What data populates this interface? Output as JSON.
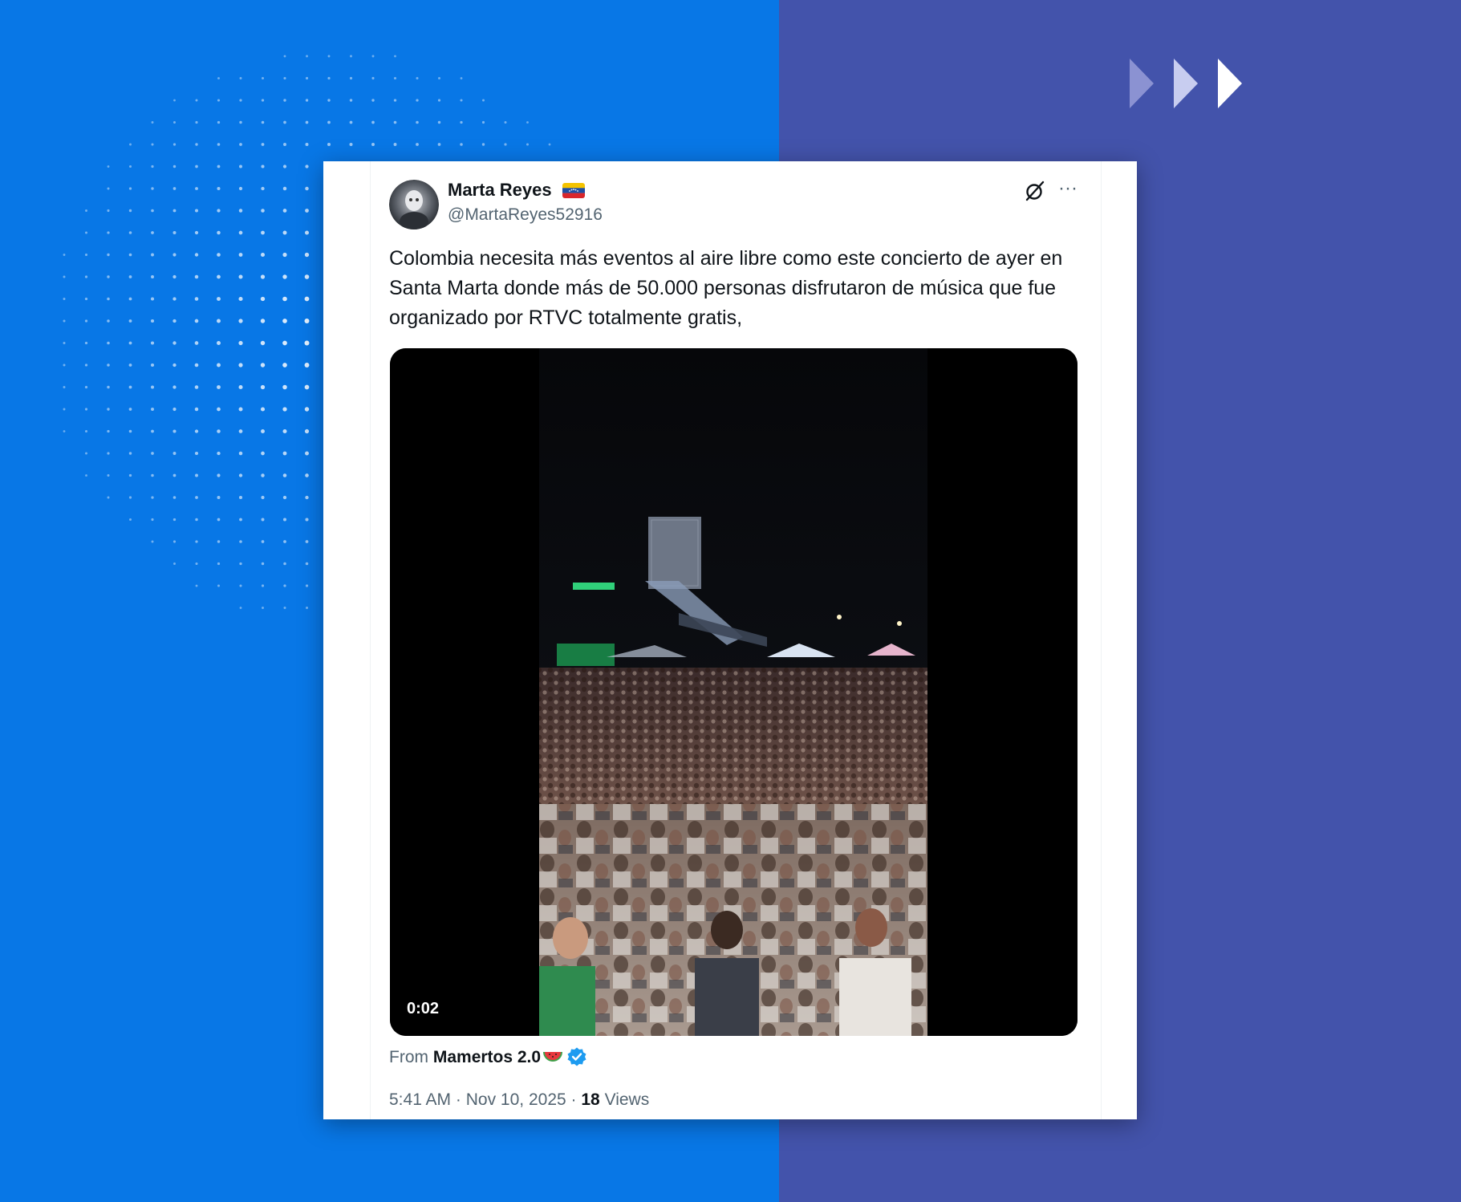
{
  "colors": {
    "left_panel": "#0877e6",
    "right_panel": "#4353ab",
    "card_bg": "#ffffff",
    "text_primary": "#0f1419",
    "text_secondary": "#536471",
    "verified": "#1d9bf0"
  },
  "decor": {
    "dot_pattern": "halftone-dots",
    "arrows": "fast-forward-arrows"
  },
  "tweet": {
    "author_name": "Marta Reyes",
    "author_flag": "venezuela-flag-icon",
    "handle": "@MartaReyes52916",
    "text": "Colombia necesita más eventos al aire libre como este concierto de ayer en Santa Marta donde más de 50.000 personas disfrutaron de música que fue organizado por RTVC totalmente gratis,",
    "video": {
      "duration": "0:02"
    },
    "source": {
      "prefix": "From",
      "name": "Mamertos 2.0",
      "emoji": "watermelon-icon",
      "badge": "verified-badge-icon"
    },
    "time": "5:41 AM",
    "separator": "·",
    "date": "Nov 10, 2025",
    "views_count": "18",
    "views_label": "Views"
  }
}
